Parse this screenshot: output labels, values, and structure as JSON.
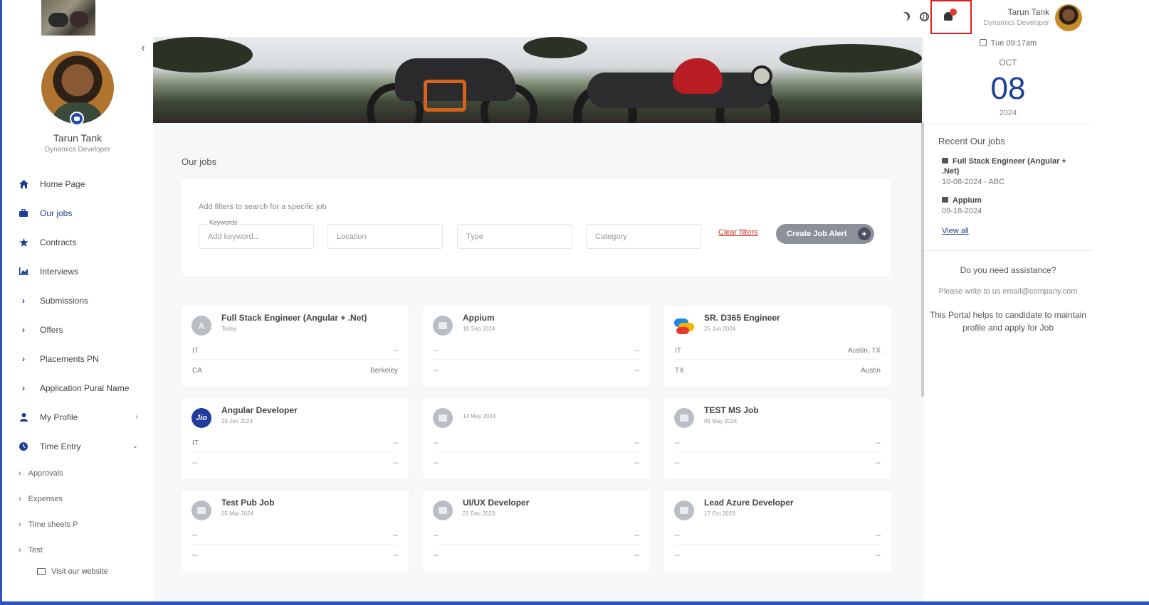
{
  "sidebar": {
    "user_name": "Tarun Tank",
    "user_role": "Dynamics Developer",
    "collapse_icon": "chevron-left-icon",
    "items": [
      {
        "label": "Home Page",
        "icon": "home-icon"
      },
      {
        "label": "Our jobs",
        "icon": "briefcase-icon"
      },
      {
        "label": "Contracts",
        "icon": "star-icon"
      },
      {
        "label": "Interviews",
        "icon": "chart-icon"
      },
      {
        "label": "Submissions",
        "icon": "chevron-right-icon"
      },
      {
        "label": "Offers",
        "icon": "chevron-right-icon"
      },
      {
        "label": "Placements PN",
        "icon": "chevron-right-icon"
      },
      {
        "label": "Application Pural Name",
        "icon": "chevron-right-icon"
      },
      {
        "label": "My Profile",
        "icon": "user-icon"
      },
      {
        "label": "Time Entry",
        "icon": "clock-icon"
      }
    ],
    "sub_items": [
      "Approvals",
      "Expenses",
      "Time sheets P",
      "Test"
    ],
    "visit_label": "Visit our website"
  },
  "main": {
    "section_title": "Our jobs",
    "filters": {
      "hint": "Add filters to search for a specific job",
      "keywords_label": "Keywords",
      "keyword_placeholder": "Add keyword...",
      "location_placeholder": "Location",
      "type_placeholder": "Type",
      "category_placeholder": "Category",
      "clear_label": "Clear filters",
      "alert_label": "Create Job Alert"
    },
    "jobs": [
      {
        "title": "Full Stack Engineer (Angular + .Net)",
        "date": "Today",
        "logo": "A",
        "row1_left": "IT",
        "row1_right": "--",
        "row2_left": "CA",
        "row2_right": "Berkeley"
      },
      {
        "title": "Appium",
        "date": "18 Sep 2024",
        "logo": "briefcase",
        "row1_left": "--",
        "row1_right": "--",
        "row2_left": "--",
        "row2_right": "--"
      },
      {
        "title": "SR. D365 Engineer",
        "date": "25 Jun 2024",
        "logo": "d365",
        "row1_left": "IT",
        "row1_right": "Austin, TX",
        "row2_left": "TX",
        "row2_right": "Austin"
      },
      {
        "title": "Angular Developer",
        "date": "25 Jun 2024",
        "logo": "Jio",
        "row1_left": "IT",
        "row1_right": "--",
        "row2_left": "--",
        "row2_right": "--"
      },
      {
        "title": "",
        "date": "14 May 2024",
        "logo": "briefcase",
        "row1_left": "--",
        "row1_right": "--",
        "row2_left": "--",
        "row2_right": "--"
      },
      {
        "title": "TEST MS Job",
        "date": "09 May 2024",
        "logo": "briefcase",
        "row1_left": "--",
        "row1_right": "--",
        "row2_left": "--",
        "row2_right": "--"
      },
      {
        "title": "Test Pub Job",
        "date": "05 Mar 2024",
        "logo": "briefcase",
        "row1_left": "--",
        "row1_right": "--",
        "row2_left": "--",
        "row2_right": "--"
      },
      {
        "title": "UI/UX Developer",
        "date": "21 Dec 2023",
        "logo": "briefcase",
        "row1_left": "--",
        "row1_right": "--",
        "row2_left": "--",
        "row2_right": "--"
      },
      {
        "title": "Lead Azure Developer",
        "date": "17 Oct 2023",
        "logo": "briefcase",
        "row1_left": "--",
        "row1_right": "--",
        "row2_left": "--",
        "row2_right": "--"
      }
    ]
  },
  "header": {
    "user_name": "Tarun Tank",
    "user_role": "Dynamics Developer"
  },
  "right_panel": {
    "datetime": "Tue 09:17am",
    "month": "OCT",
    "day": "08",
    "year": "2024",
    "recent_title": "Recent Our jobs",
    "recent_jobs": [
      {
        "title": "Full Stack Engineer (Angular + .Net)",
        "sub": "10-08-2024 - ABC"
      },
      {
        "title": "Appium",
        "sub": "09-18-2024"
      }
    ],
    "view_all": "View all",
    "assist_title": "Do you need assistance?",
    "assist_email": "Please write to us email@company.com",
    "assist_desc": "This Portal helps to candidate to maintain profile and apply for Job"
  },
  "colors": {
    "accent": "#1a3f96",
    "danger": "#d0342c",
    "button_gray": "#8b9099"
  }
}
